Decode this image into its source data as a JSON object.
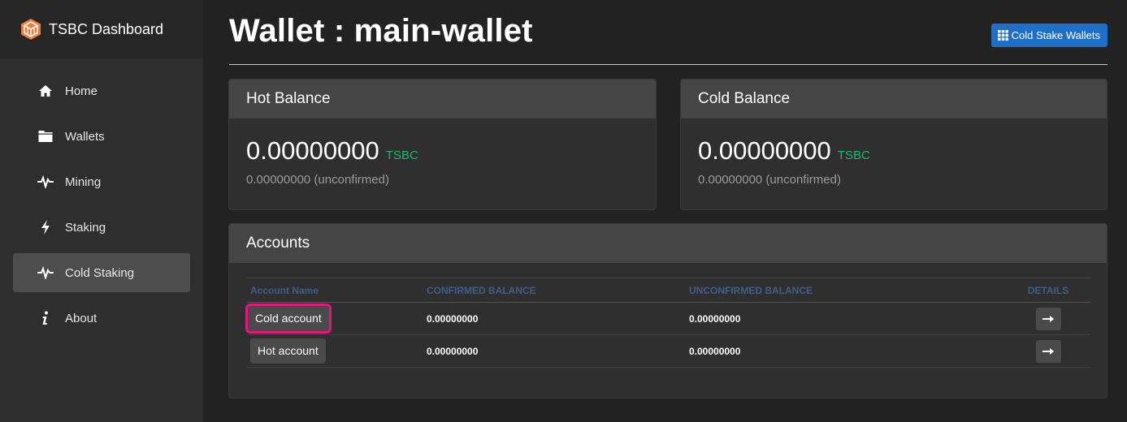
{
  "app": {
    "title": "TSBC Dashboard"
  },
  "sidebar": {
    "items": [
      {
        "label": "Home",
        "icon": "home-icon",
        "active": false
      },
      {
        "label": "Wallets",
        "icon": "folder-icon",
        "active": false
      },
      {
        "label": "Mining",
        "icon": "pulse-icon",
        "active": false
      },
      {
        "label": "Staking",
        "icon": "lightning-icon",
        "active": false
      },
      {
        "label": "Cold Staking",
        "icon": "pulse-icon",
        "active": true
      },
      {
        "label": "About",
        "icon": "info-icon",
        "active": false
      }
    ]
  },
  "header": {
    "title": "Wallet : main-wallet",
    "cold_stake_wallets_label": "Cold Stake Wallets"
  },
  "hot_balance": {
    "title": "Hot Balance",
    "amount": "0.00000000",
    "unit": "TSBC",
    "unconfirmed": "0.00000000 (unconfirmed)"
  },
  "cold_balance": {
    "title": "Cold Balance",
    "amount": "0.00000000",
    "unit": "TSBC",
    "unconfirmed": "0.00000000 (unconfirmed)"
  },
  "accounts": {
    "title": "Accounts",
    "columns": [
      "Account Name",
      "CONFIRMED BALANCE",
      "UNCONFIRMED BALANCE",
      "DETAILS"
    ],
    "rows": [
      {
        "name": "Cold account",
        "confirmed": "0.00000000",
        "unconfirmed": "0.00000000"
      },
      {
        "name": "Hot account",
        "confirmed": "0.00000000",
        "unconfirmed": "0.00000000"
      }
    ]
  },
  "colors": {
    "accent": "#1e6fc7",
    "unit": "#17b978",
    "highlight": "#e3177a",
    "logo": "#f07c3a"
  }
}
